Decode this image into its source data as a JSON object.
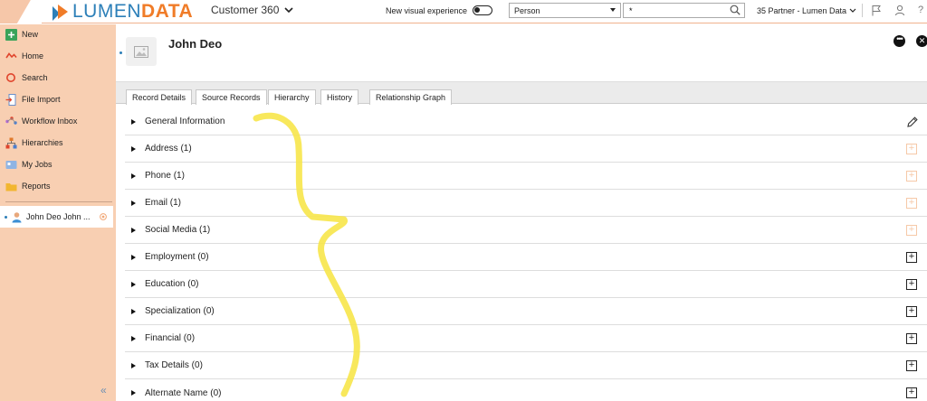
{
  "brand": {
    "name_part1": "LUMEN",
    "name_part2": "DATA"
  },
  "header": {
    "app_title": "Customer 360",
    "visual_toggle_label": "New visual experience",
    "entity_select": "Person",
    "search_value": "*",
    "tenant": "35 Partner - Lumen Data"
  },
  "sidebar": {
    "items": [
      {
        "label": "New",
        "icon": "plus-icon"
      },
      {
        "label": "Home",
        "icon": "home-icon"
      },
      {
        "label": "Search",
        "icon": "search-icon"
      },
      {
        "label": "File Import",
        "icon": "file-import-icon"
      },
      {
        "label": "Workflow Inbox",
        "icon": "workflow-icon"
      },
      {
        "label": "Hierarchies",
        "icon": "hierarchy-icon"
      },
      {
        "label": "My Jobs",
        "icon": "jobs-icon"
      },
      {
        "label": "Reports",
        "icon": "folder-icon"
      }
    ],
    "open_record": "John Deo John ..."
  },
  "record": {
    "title": "John Deo",
    "tabs": [
      "Record Details",
      "Source Records",
      "Hierarchy",
      "History",
      "Relationship Graph"
    ],
    "sections": [
      {
        "label": "General Information",
        "action": "edit"
      },
      {
        "label": "Address (1)",
        "action": "add-faint"
      },
      {
        "label": "Phone (1)",
        "action": "add-faint"
      },
      {
        "label": "Email (1)",
        "action": "add-faint"
      },
      {
        "label": "Social Media (1)",
        "action": "add-faint"
      },
      {
        "label": "Employment (0)",
        "action": "add"
      },
      {
        "label": "Education (0)",
        "action": "add"
      },
      {
        "label": "Specialization (0)",
        "action": "add"
      },
      {
        "label": "Financial (0)",
        "action": "add"
      },
      {
        "label": "Tax Details (0)",
        "action": "add"
      },
      {
        "label": "Alternate Name (0)",
        "action": "add"
      }
    ]
  },
  "colors": {
    "brand_blue": "#2c7fb8",
    "brand_orange": "#f07c28",
    "sidebar_bg": "#f8cfb2",
    "annotation_yellow": "#f7e54a"
  }
}
